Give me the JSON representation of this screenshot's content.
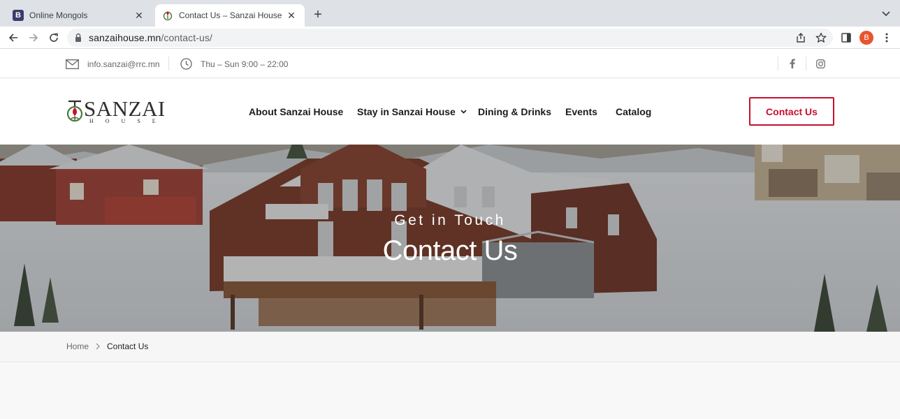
{
  "browser": {
    "tabs": [
      {
        "title": "Online Mongols",
        "favicon": "bootstrap-icon",
        "active": false
      },
      {
        "title": "Contact Us – Sanzai House",
        "favicon": "sanzai-logo-icon",
        "active": true
      }
    ],
    "url_host": "sanzaihouse.mn",
    "url_path": "/contact-us/",
    "profile_initial": "B"
  },
  "topbar": {
    "email": "info.sanzai@rrc.mn",
    "hours": "Thu – Sun 9:00 – 22:00",
    "social": [
      "facebook-icon",
      "instagram-icon"
    ]
  },
  "header": {
    "logo_word": "SANZAI",
    "logo_sub": "HOUSE",
    "nav": [
      {
        "label": "About Sanzai House"
      },
      {
        "label": "Stay in Sanzai House",
        "has_dropdown": true
      },
      {
        "label": "Dining & Drinks"
      },
      {
        "label": "Events"
      },
      {
        "label": "Catalog"
      }
    ],
    "cta_label": "Contact Us"
  },
  "hero": {
    "subtitle": "Get in Touch",
    "title": "Contact Us"
  },
  "breadcrumb": {
    "home": "Home",
    "current": "Contact Us"
  },
  "colors": {
    "accent": "#c8102e",
    "tabstrip": "#dee1e6",
    "avatar": "#e8542e"
  }
}
